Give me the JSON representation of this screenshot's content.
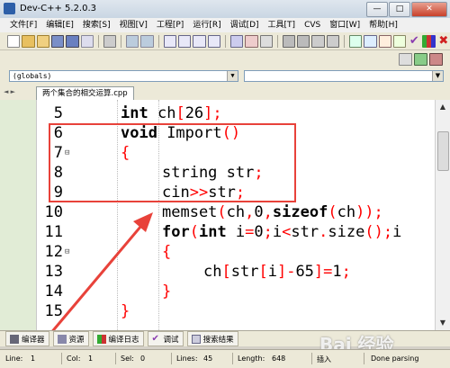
{
  "window": {
    "title": "Dev-C++ 5.2.0.3",
    "btn_min": "—",
    "btn_max": "□",
    "btn_close": "✕"
  },
  "menu": [
    "文件[F]",
    "编辑[E]",
    "搜索[S]",
    "视图[V]",
    "工程[P]",
    "运行[R]",
    "调试[D]",
    "工具[T]",
    "CVS",
    "窗口[W]",
    "帮助[H]"
  ],
  "scope": {
    "value": "(globals)"
  },
  "tabs": {
    "nav": "◄ ►",
    "active": "两个集合的相交运算.cpp"
  },
  "code_lines": [
    {
      "num": "5",
      "fold": "",
      "indent": 1,
      "segments": [
        {
          "t": "int",
          "k": "kw"
        },
        {
          "t": " ch",
          "k": ""
        },
        {
          "t": "[",
          "k": "sym"
        },
        {
          "t": "26",
          "k": ""
        },
        {
          "t": "];",
          "k": "sym"
        }
      ]
    },
    {
      "num": "6",
      "fold": "",
      "indent": 1,
      "segments": [
        {
          "t": "void",
          "k": "kw"
        },
        {
          "t": " Import",
          "k": ""
        },
        {
          "t": "()",
          "k": "sym"
        }
      ]
    },
    {
      "num": "7",
      "fold": "⊟",
      "indent": 1,
      "segments": [
        {
          "t": "{",
          "k": "sym"
        }
      ]
    },
    {
      "num": "8",
      "fold": "",
      "indent": 2,
      "segments": [
        {
          "t": "string str",
          "k": ""
        },
        {
          "t": ";",
          "k": "sym"
        }
      ]
    },
    {
      "num": "9",
      "fold": "",
      "indent": 2,
      "segments": [
        {
          "t": "cin",
          "k": ""
        },
        {
          "t": ">>",
          "k": "sym"
        },
        {
          "t": "str",
          "k": ""
        },
        {
          "t": ";",
          "k": "sym"
        }
      ]
    },
    {
      "num": "10",
      "fold": "",
      "indent": 2,
      "segments": [
        {
          "t": "memset",
          "k": ""
        },
        {
          "t": "(",
          "k": "sym"
        },
        {
          "t": "ch",
          "k": ""
        },
        {
          "t": ",",
          "k": "sym"
        },
        {
          "t": "0",
          "k": ""
        },
        {
          "t": ",",
          "k": "sym"
        },
        {
          "t": "sizeof",
          "k": "kw"
        },
        {
          "t": "(",
          "k": "sym"
        },
        {
          "t": "ch",
          "k": ""
        },
        {
          "t": "));",
          "k": "sym"
        }
      ]
    },
    {
      "num": "11",
      "fold": "",
      "indent": 2,
      "segments": [
        {
          "t": "for",
          "k": "kw"
        },
        {
          "t": "(",
          "k": "sym"
        },
        {
          "t": "int",
          "k": "kw"
        },
        {
          "t": " i",
          "k": ""
        },
        {
          "t": "=",
          "k": "sym"
        },
        {
          "t": "0",
          "k": ""
        },
        {
          "t": ";",
          "k": "sym"
        },
        {
          "t": "i",
          "k": ""
        },
        {
          "t": "<",
          "k": "sym"
        },
        {
          "t": "str",
          "k": ""
        },
        {
          "t": ".",
          "k": "sym"
        },
        {
          "t": "size",
          "k": ""
        },
        {
          "t": "();",
          "k": "sym"
        },
        {
          "t": "i",
          "k": ""
        }
      ]
    },
    {
      "num": "12",
      "fold": "⊟",
      "indent": 2,
      "segments": [
        {
          "t": "{",
          "k": "sym"
        }
      ]
    },
    {
      "num": "13",
      "fold": "",
      "indent": 3,
      "segments": [
        {
          "t": "ch",
          "k": ""
        },
        {
          "t": "[",
          "k": "sym"
        },
        {
          "t": "str",
          "k": ""
        },
        {
          "t": "[",
          "k": "sym"
        },
        {
          "t": "i",
          "k": ""
        },
        {
          "t": "]-",
          "k": "sym"
        },
        {
          "t": "65",
          "k": ""
        },
        {
          "t": "]=",
          "k": "sym"
        },
        {
          "t": "1",
          "k": ""
        },
        {
          "t": ";",
          "k": "sym"
        }
      ]
    },
    {
      "num": "14",
      "fold": "",
      "indent": 2,
      "segments": [
        {
          "t": "}",
          "k": "sym"
        }
      ]
    },
    {
      "num": "15",
      "fold": "",
      "indent": 1,
      "segments": [
        {
          "t": "}",
          "k": "sym"
        }
      ]
    }
  ],
  "bottom_tabs": [
    "编译器",
    "资源",
    "编译日志",
    "调试",
    "搜索结果"
  ],
  "status": {
    "line_label": "Line:",
    "line_val": "1",
    "col_label": "Col:",
    "col_val": "1",
    "sel_label": "Sel:",
    "sel_val": "0",
    "lines_label": "Lines:",
    "lines_val": "45",
    "length_label": "Length:",
    "length_val": "648",
    "mode": "插入",
    "state": "Done parsing"
  },
  "watermark": "Bai 经验",
  "colors": {
    "keyword": "#000000",
    "symbol": "#ff0000",
    "highlight_box": "#e8423a"
  }
}
